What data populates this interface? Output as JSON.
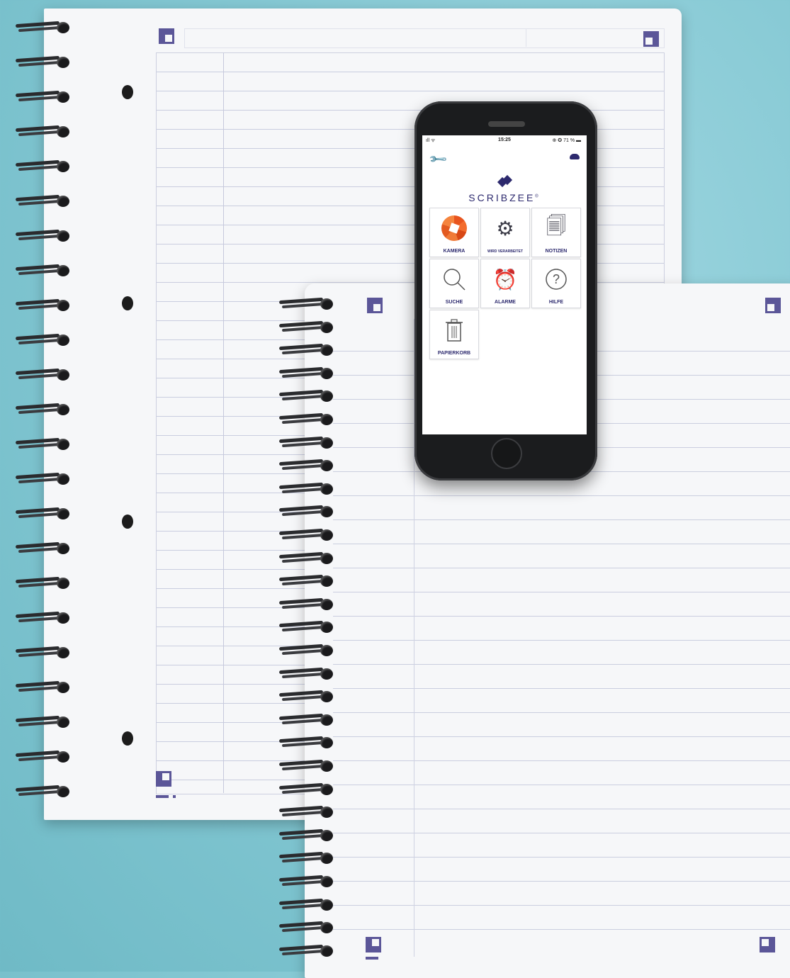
{
  "scene": {
    "description_colors": {
      "background": "#86c9d4",
      "accent": "#5b5698",
      "brand": "#2d2a6e",
      "camera": "#e8541e"
    }
  },
  "phone": {
    "status": {
      "time": "15:25",
      "signal": "ıll ᯤ",
      "battery": "⊕ ✪ 71 % ▬"
    },
    "toolbar": {
      "settings_icon": "wrench-icon",
      "cloud_icon": "cloud-icon"
    },
    "logo": {
      "text": "SCRIBZEE",
      "mark": "®"
    },
    "tiles": [
      {
        "label": "KAMERA",
        "icon": "camera-aperture-icon"
      },
      {
        "label": "WIRD VERARBEITET",
        "icon": "gears-icon"
      },
      {
        "label": "NOTIZEN",
        "icon": "notes-icon"
      },
      {
        "label": "SUCHE",
        "icon": "search-icon"
      },
      {
        "label": "ALARME",
        "icon": "alarm-icon"
      },
      {
        "label": "HILFE",
        "icon": "help-icon"
      },
      {
        "label": "PAPIERKORB",
        "icon": "trash-icon"
      }
    ]
  }
}
